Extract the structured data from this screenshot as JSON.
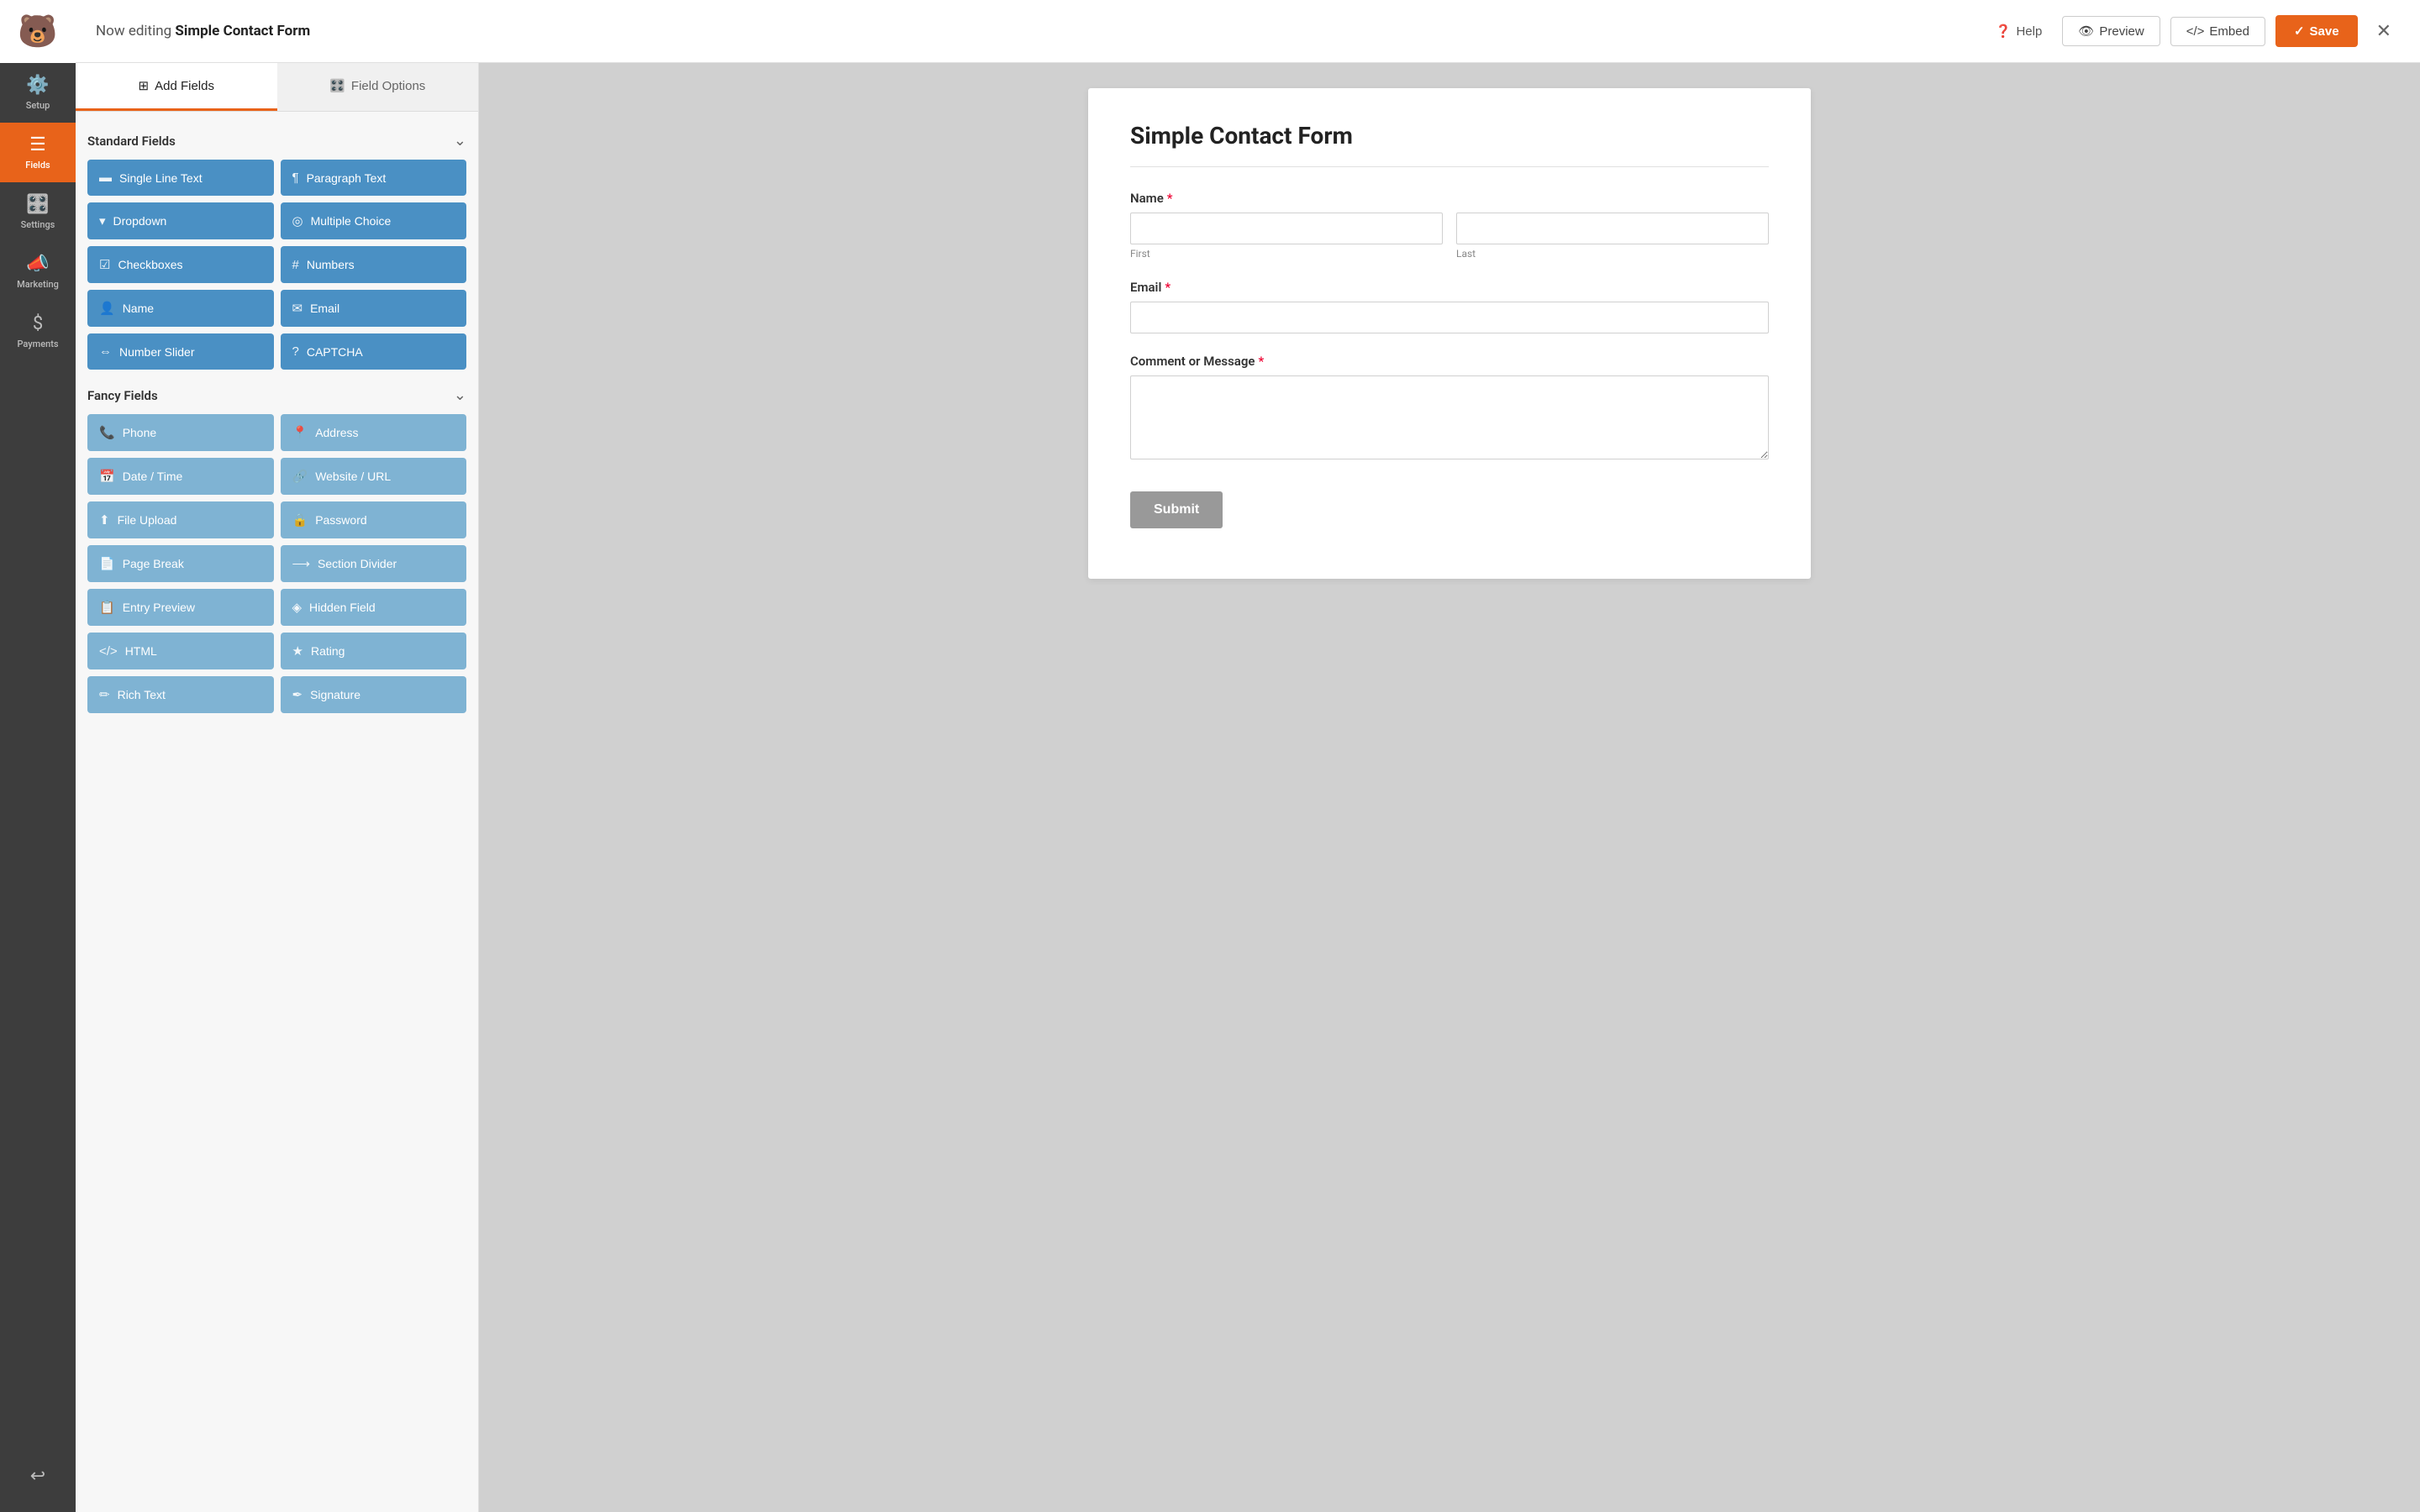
{
  "nav": {
    "logo": "🐻",
    "items": [
      {
        "id": "setup",
        "label": "Setup",
        "icon": "⚙️",
        "active": false
      },
      {
        "id": "fields",
        "label": "Fields",
        "icon": "📋",
        "active": true
      },
      {
        "id": "settings",
        "label": "Settings",
        "icon": "🎛️",
        "active": false
      },
      {
        "id": "marketing",
        "label": "Marketing",
        "icon": "📣",
        "active": false
      },
      {
        "id": "payments",
        "label": "Payments",
        "icon": "💲",
        "active": false
      }
    ],
    "bottom_icon": "↩️"
  },
  "header": {
    "editing_prefix": "Now editing ",
    "form_name": "Simple Contact Form",
    "help_label": "Help",
    "preview_label": "Preview",
    "embed_label": "Embed",
    "save_label": "Save",
    "close_label": "✕"
  },
  "tabs": [
    {
      "id": "add-fields",
      "label": "Add Fields",
      "icon": "⊞",
      "active": true
    },
    {
      "id": "field-options",
      "label": "Field Options",
      "icon": "🎛️",
      "active": false
    }
  ],
  "standard_fields": {
    "section_label": "Standard Fields",
    "items": [
      {
        "id": "single-line-text",
        "label": "Single Line Text",
        "icon": "▬"
      },
      {
        "id": "paragraph-text",
        "label": "Paragraph Text",
        "icon": "¶"
      },
      {
        "id": "dropdown",
        "label": "Dropdown",
        "icon": "▾"
      },
      {
        "id": "multiple-choice",
        "label": "Multiple Choice",
        "icon": "◎"
      },
      {
        "id": "checkboxes",
        "label": "Checkboxes",
        "icon": "☑"
      },
      {
        "id": "numbers",
        "label": "Numbers",
        "icon": "#"
      },
      {
        "id": "name",
        "label": "Name",
        "icon": "👤"
      },
      {
        "id": "email",
        "label": "Email",
        "icon": "✉"
      },
      {
        "id": "number-slider",
        "label": "Number Slider",
        "icon": "⇔"
      },
      {
        "id": "captcha",
        "label": "CAPTCHA",
        "icon": "?"
      }
    ]
  },
  "fancy_fields": {
    "section_label": "Fancy Fields",
    "items": [
      {
        "id": "phone",
        "label": "Phone",
        "icon": "📞"
      },
      {
        "id": "address",
        "label": "Address",
        "icon": "📍"
      },
      {
        "id": "date-time",
        "label": "Date / Time",
        "icon": "📅"
      },
      {
        "id": "website-url",
        "label": "Website / URL",
        "icon": "🔗"
      },
      {
        "id": "file-upload",
        "label": "File Upload",
        "icon": "⬆"
      },
      {
        "id": "password",
        "label": "Password",
        "icon": "🔒"
      },
      {
        "id": "page-break",
        "label": "Page Break",
        "icon": "📄"
      },
      {
        "id": "section-divider",
        "label": "Section Divider",
        "icon": "⟶"
      },
      {
        "id": "entry-preview",
        "label": "Entry Preview",
        "icon": "📋"
      },
      {
        "id": "hidden-field",
        "label": "Hidden Field",
        "icon": "🔮"
      },
      {
        "id": "html",
        "label": "HTML",
        "icon": "</>"
      },
      {
        "id": "rating",
        "label": "Rating",
        "icon": "★"
      },
      {
        "id": "rich-text",
        "label": "Rich Text",
        "icon": "✏"
      },
      {
        "id": "signature",
        "label": "Signature",
        "icon": "✒"
      }
    ]
  },
  "form": {
    "title": "Simple Contact Form",
    "fields": [
      {
        "id": "name-field",
        "label": "Name",
        "required": true,
        "type": "name",
        "subfields": [
          {
            "id": "first-name",
            "placeholder": "",
            "sublabel": "First"
          },
          {
            "id": "last-name",
            "placeholder": "",
            "sublabel": "Last"
          }
        ]
      },
      {
        "id": "email-field",
        "label": "Email",
        "required": true,
        "type": "email",
        "placeholder": ""
      },
      {
        "id": "comment-field",
        "label": "Comment or Message",
        "required": true,
        "type": "textarea",
        "placeholder": ""
      }
    ],
    "submit_label": "Submit"
  }
}
